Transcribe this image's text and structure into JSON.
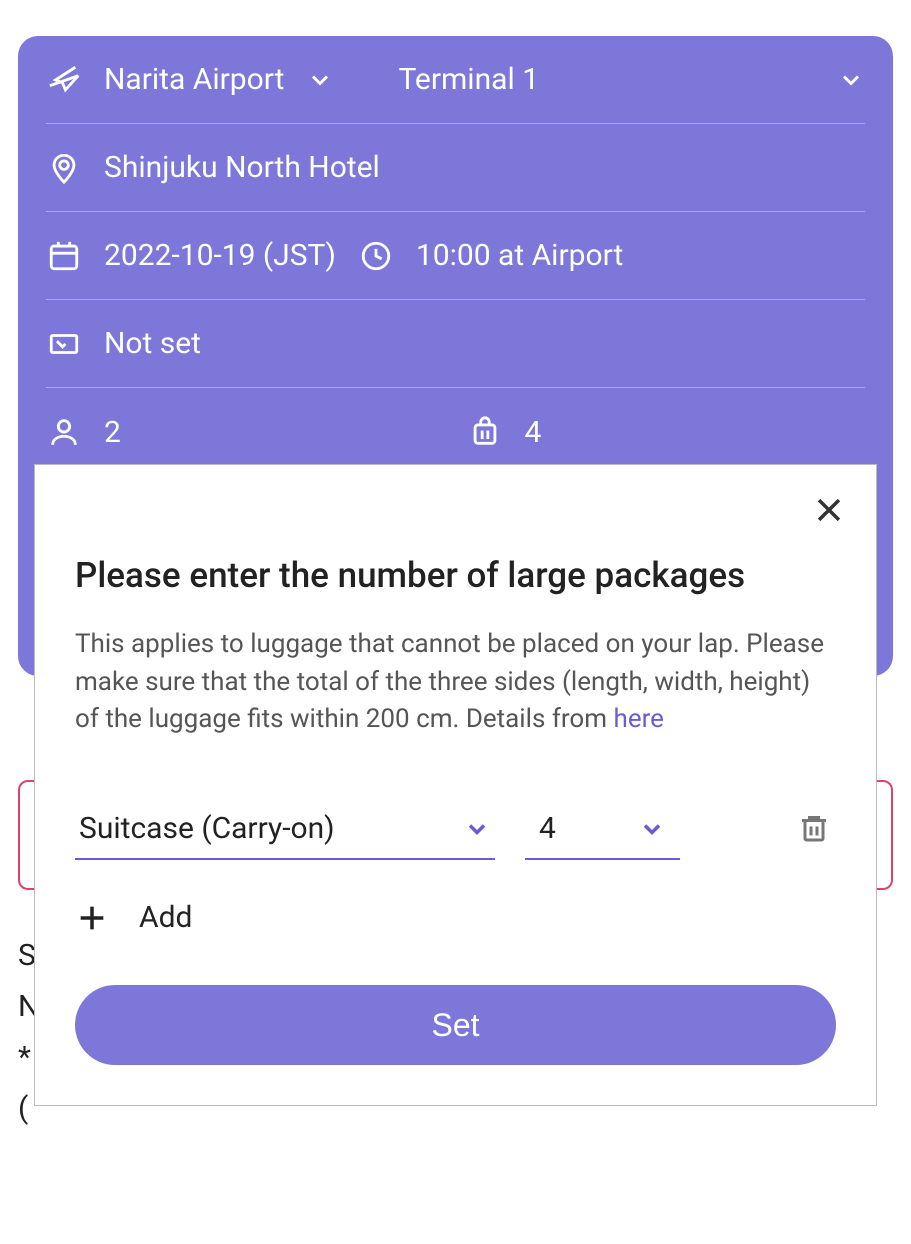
{
  "form": {
    "airport": "Narita Airport",
    "terminal": "Terminal 1",
    "destination": "Shinjuku North Hotel",
    "date": "2022-10-19 (JST)",
    "time": "10:00 at Airport",
    "flight": "Not set",
    "passengers": "2",
    "luggage": "4"
  },
  "bg": {
    "line1": "S",
    "line2": "N",
    "line3": "*",
    "line4": "("
  },
  "modal": {
    "title": "Please enter the number of large packages",
    "desc_before": "This applies to luggage that cannot be placed on your lap. Please make sure that the total of the three sides (length, width, height) of the luggage fits within 200 cm. Details from ",
    "desc_link": "here",
    "type_value": "Suitcase (Carry-on)",
    "qty_value": "4",
    "add_label": "Add",
    "set_label": "Set"
  }
}
